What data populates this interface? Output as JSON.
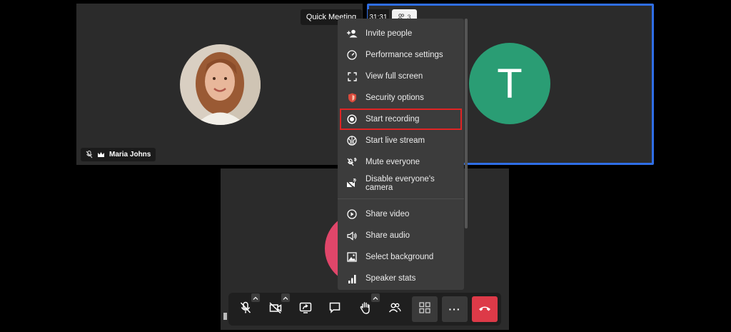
{
  "header": {
    "meeting_title": "Quick Meeting",
    "timer": "31:31",
    "participant_count": "3"
  },
  "tiles": {
    "maria": {
      "name": "Maria Johns",
      "muted": true,
      "is_moderator": true
    },
    "t": {
      "initial": "T",
      "avatar_color": "#2a9d74",
      "active_speaker": true
    },
    "local": {
      "avatar_color": "#e0466a"
    }
  },
  "menu": {
    "items": [
      {
        "label": "Invite people",
        "icon": "add-person-icon"
      },
      {
        "label": "Performance settings",
        "icon": "gauge-icon"
      },
      {
        "label": "View full screen",
        "icon": "fullscreen-icon"
      },
      {
        "label": "Security options",
        "icon": "shield-icon"
      },
      {
        "label": "Start recording",
        "icon": "record-icon",
        "highlighted": true
      },
      {
        "label": "Start live stream",
        "icon": "live-stream-icon"
      },
      {
        "label": "Mute everyone",
        "icon": "mute-all-icon"
      },
      {
        "label": "Disable everyone's camera",
        "icon": "camera-off-all-icon"
      }
    ],
    "items_after_divider": [
      {
        "label": "Share video",
        "icon": "play-icon"
      },
      {
        "label": "Share audio",
        "icon": "speaker-icon"
      },
      {
        "label": "Select background",
        "icon": "image-icon"
      },
      {
        "label": "Speaker stats",
        "icon": "bar-chart-icon"
      }
    ]
  },
  "toolbar": {
    "buttons": [
      "microphone-muted",
      "camera-off",
      "screen-share",
      "chat",
      "raise-hand",
      "participants",
      "tile-view",
      "more-actions",
      "leave-call"
    ],
    "more_label": "···"
  },
  "colors": {
    "accent_blue": "#2f6ee6",
    "highlight_red": "#e02424",
    "hangup_red": "#dd3a48"
  }
}
